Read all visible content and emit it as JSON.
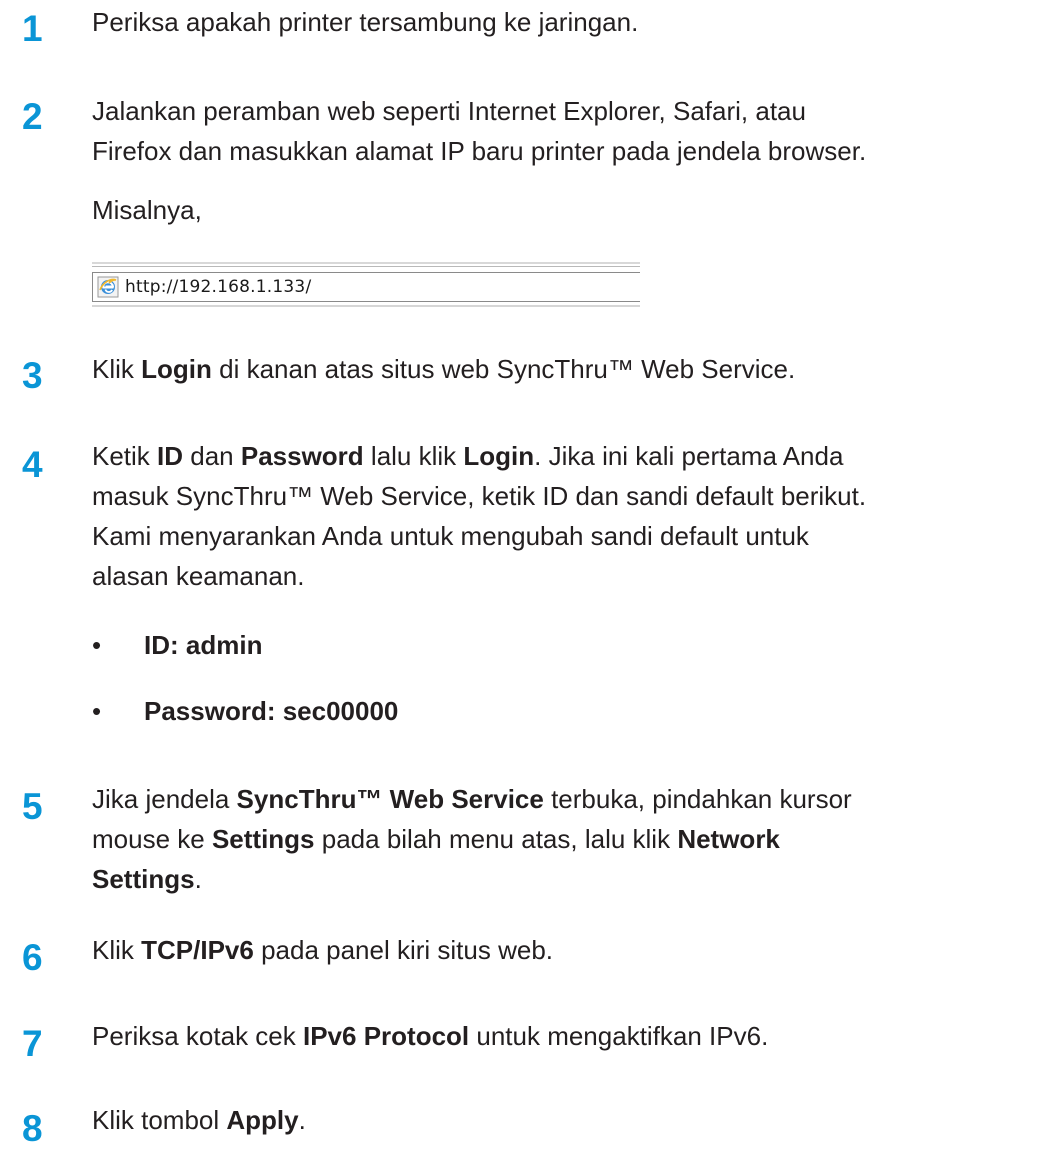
{
  "steps": [
    {
      "number": "1",
      "text": "Periksa apakah printer tersambung ke jaringan."
    },
    {
      "number": "2",
      "line1": "Jalankan peramban web seperti Internet Explorer, Safari, atau",
      "line2": "Firefox dan masukkan alamat IP baru printer pada jendela browser.",
      "example_label": "Misalnya,"
    },
    {
      "number": "3",
      "pre": "Klik ",
      "bold1": "Login",
      "post": " di kanan atas situs web SyncThru™ Web Service."
    },
    {
      "number": "4",
      "pre": "Ketik ",
      "bold1": "ID",
      "mid1": " dan ",
      "bold2": "Password",
      "mid2": " lalu klik ",
      "bold3": "Login",
      "post1": ". Jika ini kali pertama Anda",
      "line2": "masuk SyncThru™ Web Service, ketik ID dan sandi default berikut.",
      "line3": "Kami menyarankan Anda untuk mengubah sandi default untuk",
      "line4": "alasan keamanan.",
      "bullets": [
        "ID: admin",
        "Password: sec00000"
      ]
    },
    {
      "number": "5",
      "pre": "Jika jendela ",
      "bold1": "SyncThru™ Web Service",
      "post1": " terbuka, pindahkan kursor",
      "pre2": "mouse ke ",
      "bold2": "Settings",
      "mid2": " pada bilah menu atas, lalu klik ",
      "bold3": "Network",
      "bold4": "Settings",
      "post3": "."
    },
    {
      "number": "6",
      "pre": "Klik ",
      "bold1": "TCP/IPv6",
      "post": " pada panel kiri situs web."
    },
    {
      "number": "7",
      "pre": "Periksa kotak cek ",
      "bold1": "IPv6 Protocol",
      "post": " untuk mengaktifkan IPv6."
    },
    {
      "number": "8",
      "pre": "Klik tombol ",
      "bold1": "Apply",
      "post": "."
    }
  ],
  "address_bar": {
    "url": "http://192.168.1.133/",
    "icon": "internet-explorer-icon"
  },
  "colors": {
    "step_number": "#0a95d6",
    "text": "#231f20"
  }
}
